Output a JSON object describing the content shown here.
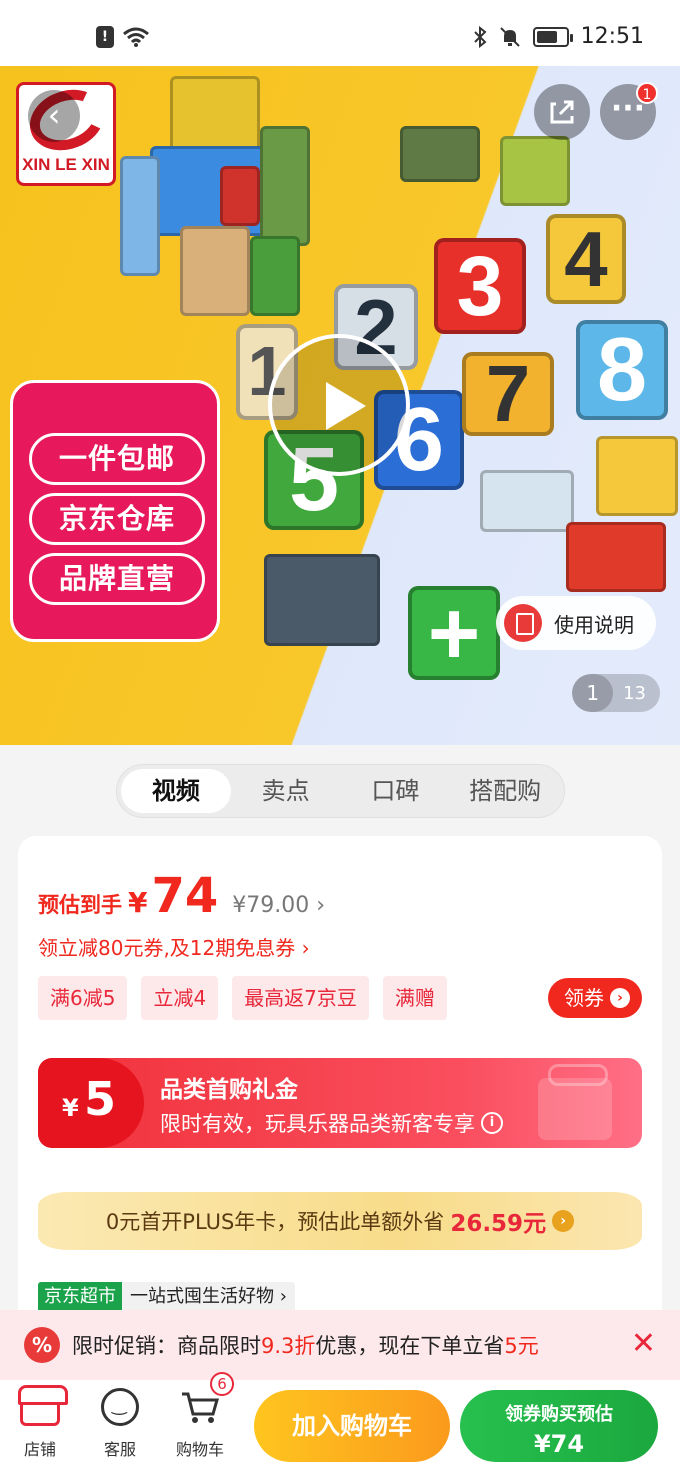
{
  "status_bar": {
    "time": "12:51",
    "alert": "!"
  },
  "hero": {
    "brand": "XIN LE XIN",
    "more_badge": "1",
    "promo_badges": [
      "一件包邮",
      "京东仓库",
      "品牌直营"
    ],
    "number_blocks": [
      "1",
      "2",
      "3",
      "4",
      "5",
      "6",
      "7",
      "8",
      "+"
    ],
    "manual_label": "使用说明",
    "pager_current": "1",
    "pager_total": "13"
  },
  "tabs": [
    {
      "label": "视频",
      "active": true
    },
    {
      "label": "卖点",
      "active": false
    },
    {
      "label": "口碑",
      "active": false
    },
    {
      "label": "搭配购",
      "active": false
    }
  ],
  "price": {
    "label": "预估到手",
    "currency": "¥",
    "value": "74",
    "original": "¥79.00",
    "coupon_line": "领立减80元券,及12期免息券",
    "tags": [
      "满6减5",
      "立减4",
      "最高返7京豆",
      "满赠"
    ],
    "get_coupon": "领券"
  },
  "gift": {
    "currency": "¥",
    "amount": "5",
    "title": "品类首购礼金",
    "subtitle": "限时有效，玩具乐器品类新客专享"
  },
  "plus": {
    "text": "0元首开PLUS年卡，预估此单额外省",
    "amount": "26.59元"
  },
  "market": {
    "badge": "京东超市",
    "text": "一站式囤生活好物"
  },
  "flash_sale": {
    "icon": "%",
    "prefix": "限时促销：商品限时",
    "discount": "9.3折",
    "middle": "优惠，现在下单立省",
    "save": "5元"
  },
  "bottom_bar": {
    "shop": "店铺",
    "service": "客服",
    "cart": "购物车",
    "cart_count": "6",
    "add_to_cart": "加入购物车",
    "buy_line1": "领券购买预估",
    "buy_line2": "¥74"
  },
  "colors": {
    "accent": "#f0281e",
    "green": "#1ba83f",
    "orange": "#fb9a1d"
  }
}
